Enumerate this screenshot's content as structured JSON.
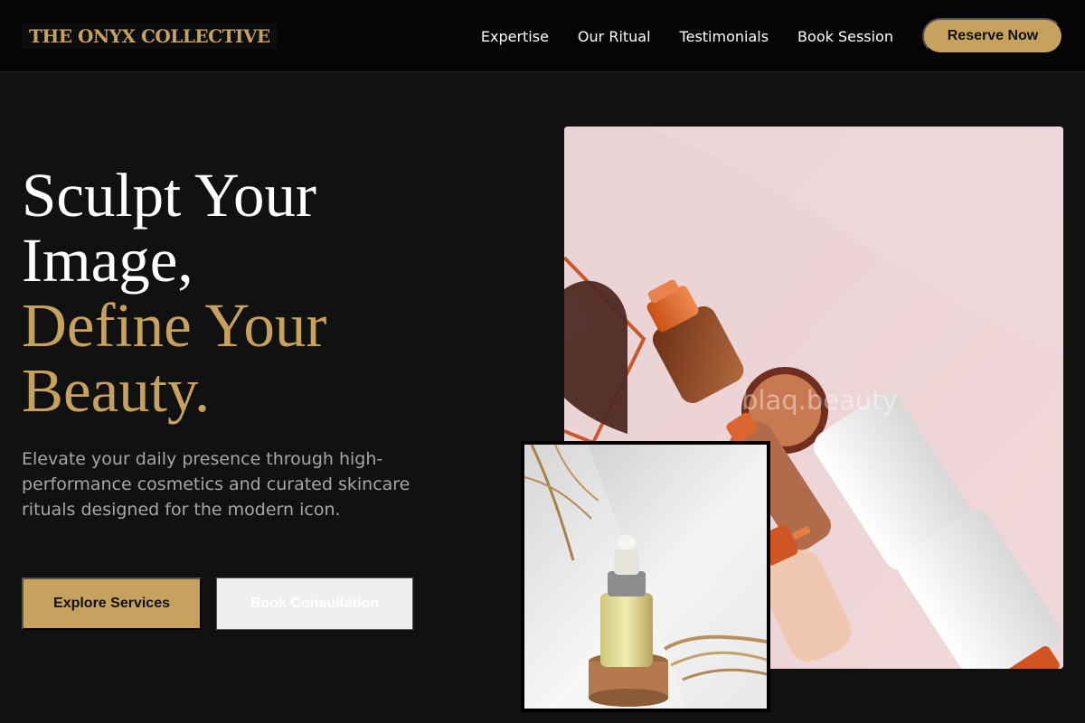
{
  "brand": {
    "name": "THE ONYX COLLECTIVE",
    "accent_color": "#c7a25e"
  },
  "nav": {
    "links": [
      "Expertise",
      "Our Ritual",
      "Testimonials",
      "Book Session"
    ],
    "cta_label": "Reserve Now"
  },
  "hero": {
    "heading_line1": "Sculpt Your",
    "heading_line2": "Image,",
    "heading_accent_line1": "Define Your",
    "heading_accent_line2": "Beauty.",
    "description": "Elevate your daily presence through high-performance cosmetics and curated skincare rituals designed for the modern icon.",
    "primary_button": "Explore Services",
    "secondary_button": "Book Consultation"
  },
  "images": {
    "main_watermark": "blaq.beauty"
  }
}
